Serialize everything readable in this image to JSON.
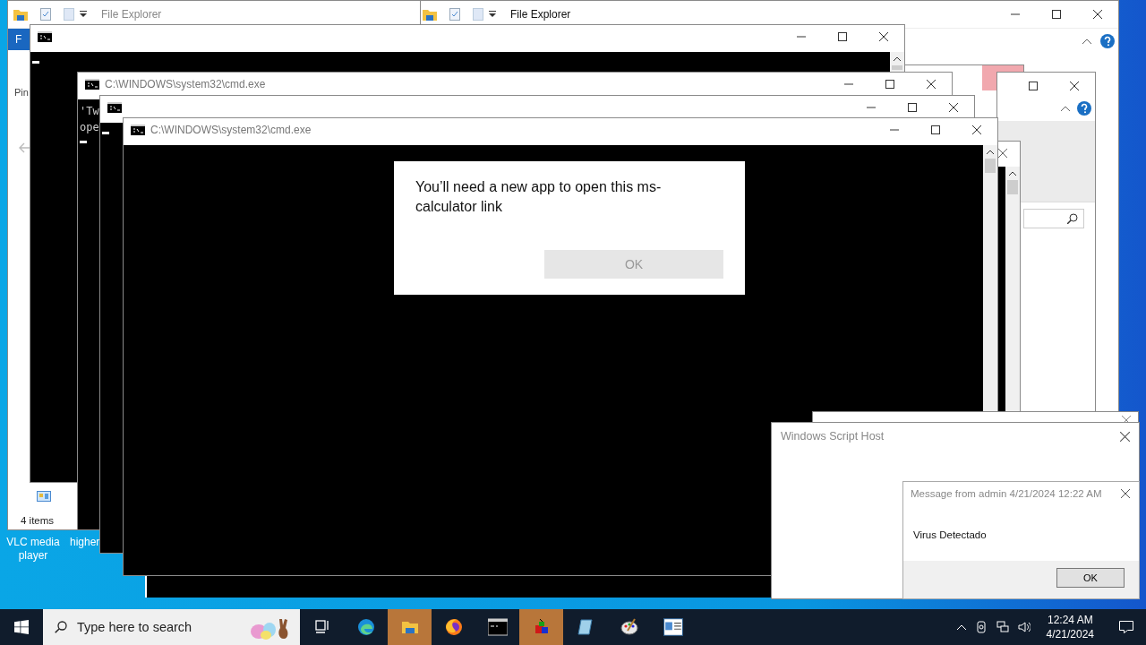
{
  "desktop_icons": [
    {
      "label": "VLC media player"
    },
    {
      "label": "higher"
    }
  ],
  "explorer_windows": [
    {
      "title": "File Explorer",
      "ribbon_tab": "F",
      "nav_item": "Pin",
      "status": "4 items"
    },
    {
      "title": "File Explorer"
    }
  ],
  "console_windows": [
    {
      "cursor": true
    },
    {
      "title": "C:\\WINDOWS\\system32\\cmd.exe",
      "output_lines": [
        "'Tw",
        "ope"
      ],
      "cursor": true
    },
    {
      "cursor": true
    },
    {
      "title": "C:\\WINDOWS\\system32\\cmd.exe",
      "cursor": false
    }
  ],
  "app_dialog": {
    "message": "You’ll need a new app to open this ms-calculator link",
    "button": "OK",
    "disabled": true
  },
  "script_host": {
    "title": "Windows Script Host"
  },
  "message_box": {
    "title": "Message from admin 4/21/2024 12:22 AM",
    "message": "Virus Detectado",
    "button": "OK"
  },
  "taskbar": {
    "search_placeholder": "Type here to search",
    "apps": [
      {
        "kind": "taskview",
        "selected": false
      },
      {
        "kind": "edge",
        "selected": false
      },
      {
        "kind": "explorer",
        "selected": true
      },
      {
        "kind": "firefox",
        "selected": false
      },
      {
        "kind": "console",
        "selected": false
      },
      {
        "kind": "boxes",
        "selected": true
      },
      {
        "kind": "notebook",
        "selected": false
      },
      {
        "kind": "paint",
        "selected": false
      },
      {
        "kind": "window",
        "selected": false
      }
    ],
    "time": "12:24 AM",
    "date": "4/21/2024"
  }
}
